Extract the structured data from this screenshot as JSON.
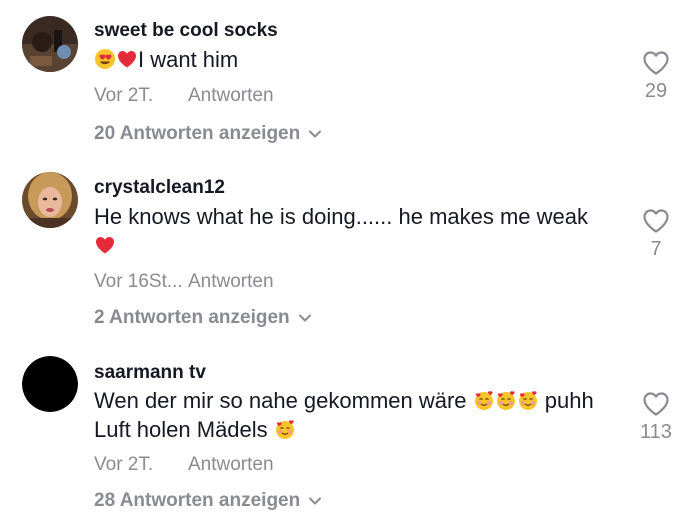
{
  "comments": [
    {
      "username": "sweet be cool socks",
      "text_after_emoji": "I want him",
      "time": "Vor 2T.",
      "reply_label": "Antworten",
      "likes": "29",
      "view_replies": "20 Antworten anzeigen",
      "avatar_icon": "photo-avatar-dark",
      "emojis": [
        "heart-eyes-emoji",
        "red-heart-emoji"
      ]
    },
    {
      "username": "crystalclean12",
      "text": "He knows what he is doing...... he makes me weak",
      "time": "Vor 16St...",
      "reply_label": "Antworten",
      "likes": "7",
      "view_replies": "2 Antworten anzeigen",
      "avatar_icon": "photo-avatar-blonde",
      "emojis": [
        "red-heart-emoji"
      ]
    },
    {
      "username": "saarmann tv",
      "text_line1": "Wen der mir so nahe gekommen wäre",
      "text_line1_end": "puhh",
      "text_line2": "Luft holen Mädels",
      "time": "Vor 2T.",
      "reply_label": "Antworten",
      "likes": "113",
      "view_replies": "28 Antworten anzeigen",
      "avatar_icon": "black-circle-avatar",
      "emojis": [
        "smiling-face-with-hearts-emoji"
      ]
    }
  ],
  "colors": {
    "primary_text": "#161823",
    "secondary_text": "#8a8b91",
    "heart_red": "#e52b3a"
  }
}
